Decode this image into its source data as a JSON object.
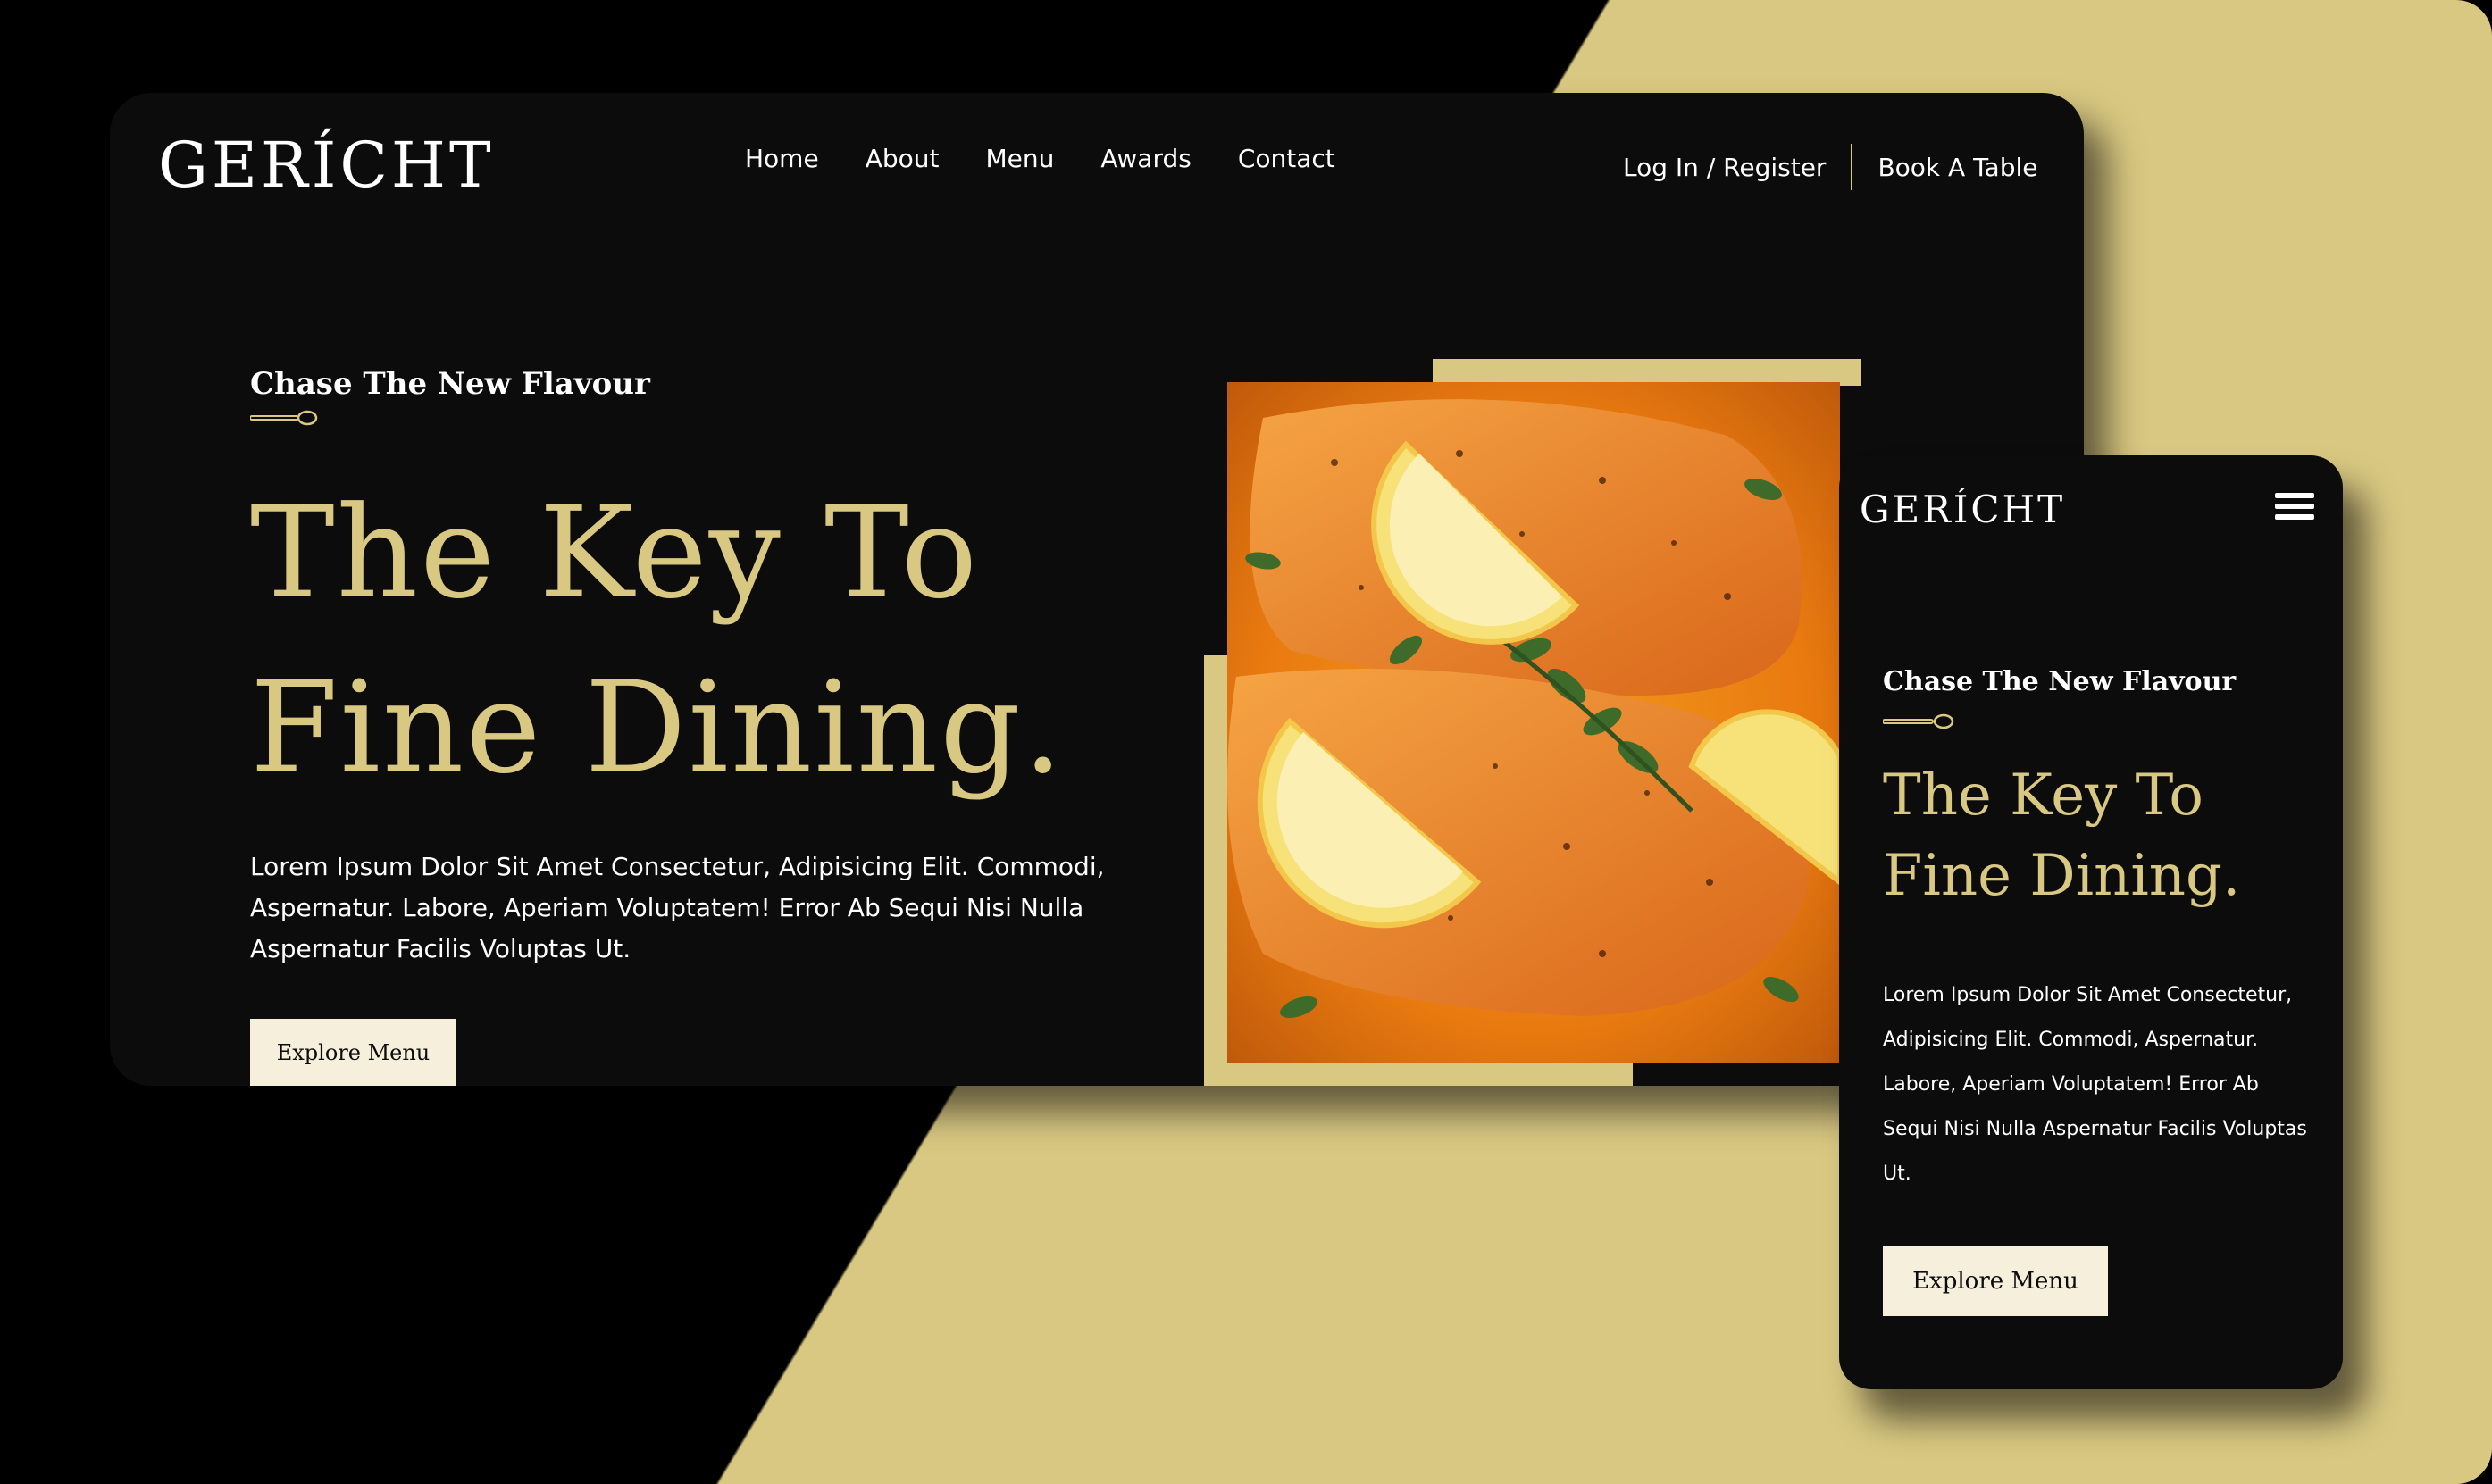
{
  "brand": {
    "logo": "GERÍCHT"
  },
  "nav": {
    "home": "Home",
    "about": "About",
    "menu": "Menu",
    "awards": "Awards",
    "contact": "Contact"
  },
  "nav_right": {
    "login": "Log In / Register",
    "book": "Book A Table"
  },
  "hero": {
    "tagline": "Chase The New Flavour",
    "headline_line1": "The Key To",
    "headline_line2": "Fine Dining.",
    "body": "Lorem Ipsum Dolor Sit Amet Consectetur, Adipisicing Elit. Commodi, Aspernatur. Labore, Aperiam Voluptatem! Error Ab Sequi Nisi Nulla Aspernatur Facilis Voluptas Ut.",
    "button": "Explore Menu"
  },
  "mobile": {
    "logo": "GERÍCHT",
    "tagline": "Chase The New Flavour",
    "headline_line1": "The Key To",
    "headline_line2": "Fine Dining.",
    "body": "Lorem Ipsum Dolor Sit Amet Consectetur, Adipisicing Elit. Commodi, Aspernatur. Labore, Aperiam Voluptatem! Error Ab Sequi Nisi Nulla Aspernatur Facilis Voluptas Ut.",
    "button": "Explore Menu"
  },
  "colors": {
    "accent": "#d9c882",
    "background": "#0c0c0c",
    "button_bg": "#f5efdb"
  },
  "icons": {
    "menu": "hamburger-menu-icon",
    "divider": "spoon-icon",
    "hero_image": "salmon-dish-image"
  }
}
